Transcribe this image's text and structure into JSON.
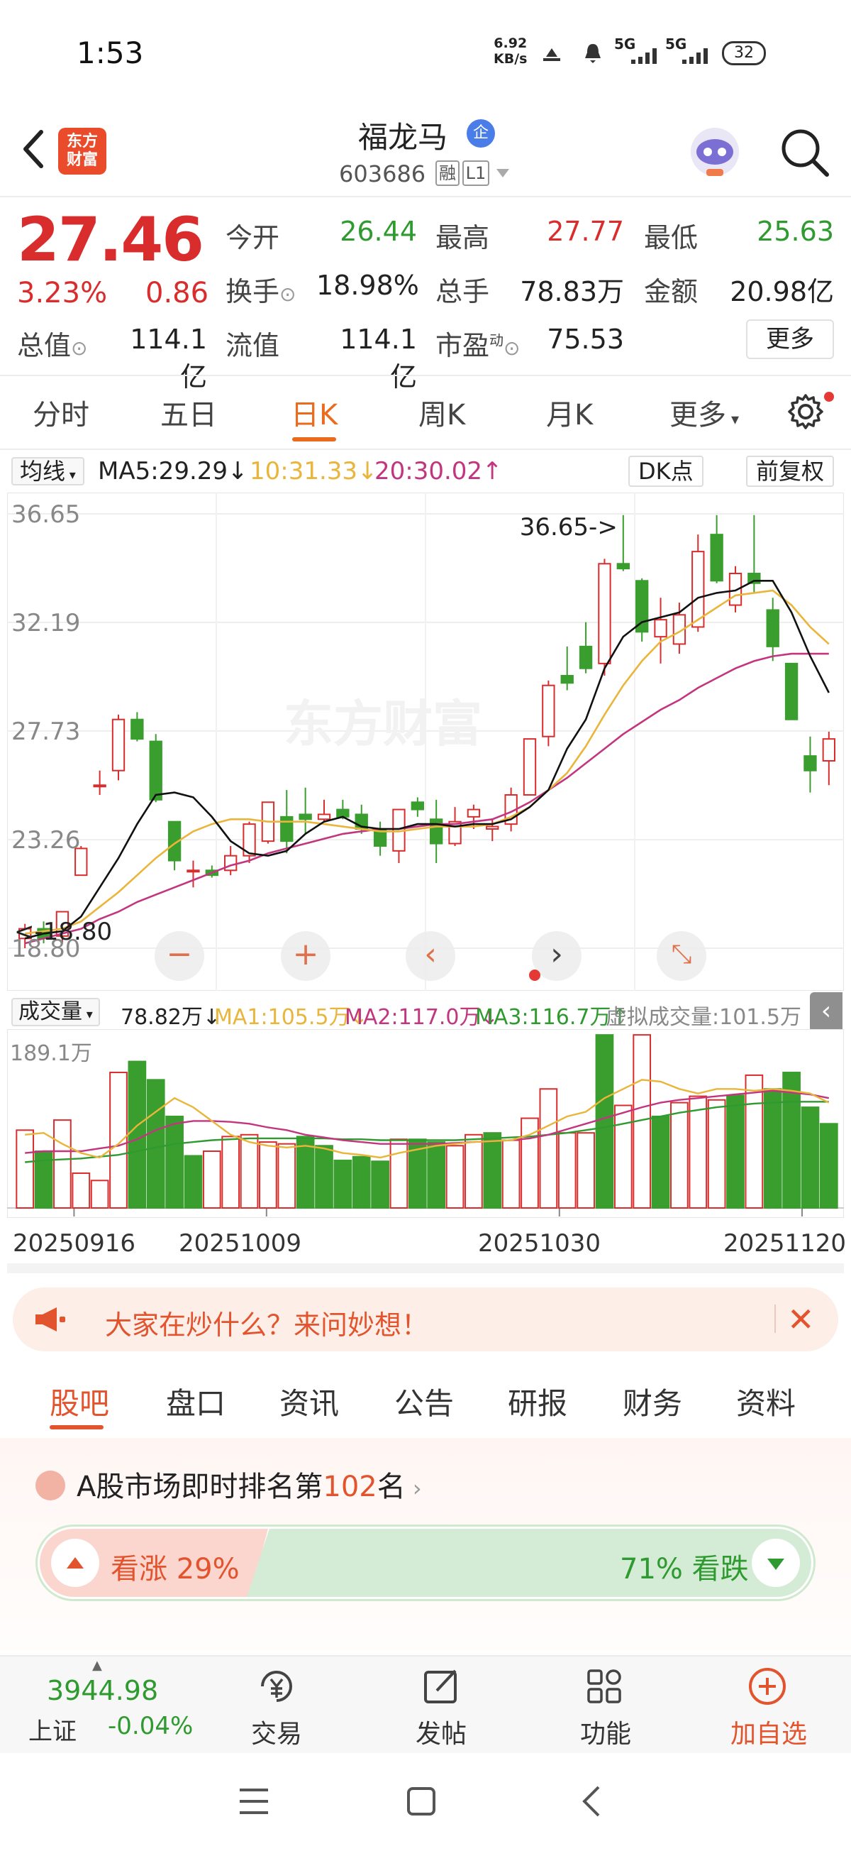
{
  "status_bar": {
    "time": "1:53",
    "net_speed_value": "6.92",
    "net_speed_unit": "KB/s",
    "signal_1": "5G",
    "signal_2": "5G",
    "battery": "32"
  },
  "header": {
    "brand_logo_line1": "东方",
    "brand_logo_line2": "财富",
    "stock_name": "福龙马",
    "qi_badge": "企",
    "stock_code": "603686",
    "tag_rong": "融",
    "tag_level": "L1"
  },
  "quote": {
    "last_price": "27.46",
    "change_pct": "3.23%",
    "change_abs": "0.86",
    "open_label": "今开",
    "open_value": "26.44",
    "high_label": "最高",
    "high_value": "27.77",
    "low_label": "最低",
    "low_value": "25.63",
    "turnover_label": "换手",
    "turnover_value": "18.98%",
    "volume_label": "总手",
    "volume_value": "78.83万",
    "amount_label": "金额",
    "amount_value": "20.98亿",
    "total_mv_label": "总值",
    "total_mv_value": "114.1亿",
    "float_mv_label": "流值",
    "float_mv_value": "114.1亿",
    "pe_label": "市盈",
    "pe_sup": "动",
    "pe_value": "75.53",
    "more_label": "更多"
  },
  "chart_tabs": [
    "分时",
    "五日",
    "日K",
    "周K",
    "月K",
    "更多"
  ],
  "chart_tabs_active": 2,
  "ma_bar": {
    "select_label": "均线",
    "ma5": "MA5:29.29↓",
    "ma10": "10:31.33↓",
    "ma20": "20:30.02↑",
    "dk_label": "DK点",
    "fq_label": "前复权"
  },
  "volume_bar": {
    "select_label": "成交量",
    "vol": "78.82万↓",
    "ma1": "MA1:105.5万↓",
    "ma2": "MA2:117.0万↓",
    "ma3": "MA3:116.7万↑",
    "virtual": "虚拟成交量:101.5万",
    "ymax_label": "189.1万"
  },
  "dates": [
    "20250916",
    "20251009",
    "20251030",
    "20251120"
  ],
  "colors": {
    "up": "#d92d2d",
    "down": "#3a9e2e",
    "ma5": "#111111",
    "ma10": "#e9b53a",
    "ma20": "#c2357f",
    "accent": "#ea6b1e"
  },
  "chart_data": {
    "type": "candlestick",
    "y_ticks": [
      "36.65",
      "32.19",
      "27.73",
      "23.26",
      "18.80"
    ],
    "ylim": [
      18.8,
      36.65
    ],
    "annotation_high": "36.65->",
    "annotation_low": "<-18.80",
    "candles": [
      [
        19.2,
        19.8,
        18.8,
        19.6
      ],
      [
        19.6,
        19.9,
        19.0,
        19.2
      ],
      [
        19.3,
        20.3,
        19.0,
        20.3
      ],
      [
        21.8,
        23.0,
        21.8,
        22.9
      ],
      [
        25.5,
        26.1,
        25.1,
        25.5
      ],
      [
        26.1,
        28.4,
        25.7,
        28.2
      ],
      [
        28.2,
        28.5,
        27.3,
        27.4
      ],
      [
        27.3,
        27.6,
        24.8,
        24.9
      ],
      [
        24.0,
        24.0,
        22.0,
        22.4
      ],
      [
        22.0,
        22.4,
        21.3,
        22.0
      ],
      [
        22.0,
        22.2,
        21.7,
        21.8
      ],
      [
        22.0,
        23.0,
        21.8,
        22.6
      ],
      [
        22.6,
        24.0,
        22.3,
        23.9
      ],
      [
        23.2,
        24.8,
        23.1,
        24.8
      ],
      [
        24.2,
        25.3,
        22.7,
        23.2
      ],
      [
        24.3,
        25.4,
        23.5,
        24.1
      ],
      [
        24.1,
        24.9,
        24.0,
        24.3
      ],
      [
        24.5,
        24.9,
        24.1,
        24.2
      ],
      [
        24.3,
        24.7,
        23.5,
        23.7
      ],
      [
        23.7,
        24.0,
        22.6,
        23.0
      ],
      [
        22.8,
        24.5,
        22.3,
        24.5
      ],
      [
        24.8,
        25.0,
        24.2,
        24.5
      ],
      [
        24.1,
        24.9,
        22.3,
        23.1
      ],
      [
        23.1,
        24.6,
        23.0,
        24.0
      ],
      [
        24.2,
        24.7,
        23.7,
        24.5
      ],
      [
        23.7,
        24.1,
        23.2,
        23.8
      ],
      [
        23.9,
        25.4,
        23.6,
        25.1
      ],
      [
        25.1,
        27.4,
        25.1,
        27.4
      ],
      [
        27.5,
        29.8,
        27.1,
        29.6
      ],
      [
        30.0,
        31.2,
        29.4,
        29.7
      ],
      [
        31.2,
        32.2,
        30.1,
        30.3
      ],
      [
        30.5,
        34.8,
        30.0,
        34.6
      ],
      [
        34.6,
        36.6,
        34.3,
        34.4
      ],
      [
        33.9,
        34.0,
        31.4,
        31.8
      ],
      [
        31.6,
        33.2,
        30.5,
        32.3
      ],
      [
        31.3,
        33.0,
        30.9,
        32.5
      ],
      [
        32.0,
        35.8,
        31.8,
        35.1
      ],
      [
        35.8,
        36.6,
        33.8,
        33.9
      ],
      [
        32.9,
        34.5,
        32.6,
        34.2
      ],
      [
        34.2,
        36.6,
        33.4,
        33.8
      ],
      [
        32.7,
        33.2,
        30.6,
        31.2
      ],
      [
        30.5,
        30.5,
        28.4,
        28.2
      ],
      [
        26.7,
        27.5,
        25.2,
        26.1
      ],
      [
        26.5,
        27.7,
        25.5,
        27.4
      ]
    ],
    "ma5": [
      19.2,
      19.4,
      19.5,
      20.1,
      21.3,
      22.5,
      23.9,
      25.1,
      25.2,
      25.0,
      24.2,
      23.2,
      22.7,
      22.6,
      22.8,
      23.5,
      24.0,
      24.2,
      23.8,
      23.7,
      23.7,
      23.9,
      23.9,
      23.8,
      23.9,
      23.9,
      24.1,
      24.6,
      25.3,
      27.0,
      28.2,
      30.3,
      31.6,
      32.2,
      32.4,
      32.6,
      33.2,
      33.4,
      33.5,
      33.9,
      33.9,
      32.6,
      30.8,
      29.3
    ],
    "ma10": [
      19.4,
      19.5,
      19.6,
      19.9,
      20.5,
      21.1,
      21.8,
      22.5,
      23.1,
      23.6,
      23.9,
      24.1,
      24.1,
      24.0,
      24.0,
      24.0,
      23.9,
      23.8,
      23.7,
      23.6,
      23.6,
      23.7,
      23.8,
      23.8,
      23.8,
      23.9,
      24.2,
      24.6,
      25.3,
      26.0,
      27.1,
      28.4,
      29.6,
      30.6,
      31.4,
      31.8,
      32.3,
      32.8,
      33.3,
      33.4,
      33.5,
      32.9,
      32.0,
      31.3
    ],
    "ma20": [
      19.0,
      19.2,
      19.4,
      19.6,
      20.0,
      20.3,
      20.7,
      21.0,
      21.3,
      21.6,
      21.9,
      22.2,
      22.4,
      22.7,
      22.9,
      23.1,
      23.3,
      23.5,
      23.6,
      23.7,
      23.7,
      23.8,
      23.9,
      23.9,
      24.0,
      24.1,
      24.4,
      24.8,
      25.3,
      25.8,
      26.4,
      27.0,
      27.6,
      28.1,
      28.6,
      29.0,
      29.5,
      29.9,
      30.3,
      30.6,
      30.8,
      30.9,
      30.9,
      30.9
    ],
    "volume": {
      "ylim": [
        0,
        189.1
      ],
      "values": [
        85,
        62,
        96,
        38,
        30,
        148,
        160,
        140,
        100,
        57,
        62,
        78,
        80,
        72,
        70,
        78,
        68,
        52,
        56,
        51,
        75,
        75,
        72,
        68,
        80,
        82,
        74,
        98,
        130,
        82,
        82,
        189,
        112,
        189,
        100,
        115,
        122,
        118,
        123,
        145,
        130,
        148,
        110,
        92,
        79
      ],
      "up": [
        true,
        false,
        true,
        true,
        true,
        true,
        false,
        false,
        false,
        false,
        true,
        true,
        true,
        true,
        true,
        false,
        false,
        false,
        false,
        false,
        true,
        false,
        false,
        true,
        true,
        false,
        true,
        true,
        true,
        true,
        true,
        false,
        true,
        true,
        false,
        true,
        true,
        true,
        false,
        true,
        false,
        false,
        false,
        false,
        true
      ],
      "ma1": [
        80,
        82,
        70,
        60,
        55,
        70,
        90,
        105,
        120,
        110,
        95,
        80,
        72,
        68,
        66,
        68,
        65,
        60,
        58,
        55,
        60,
        64,
        68,
        70,
        72,
        73,
        74,
        80,
        90,
        100,
        105,
        120,
        130,
        140,
        138,
        130,
        125,
        130,
        130,
        128,
        130,
        128,
        125,
        115,
        105
      ],
      "ma2": [
        60,
        62,
        62,
        62,
        65,
        68,
        75,
        85,
        92,
        95,
        95,
        94,
        92,
        88,
        85,
        80,
        77,
        74,
        72,
        70,
        70,
        70,
        70,
        71,
        72,
        73,
        74,
        76,
        80,
        86,
        92,
        98,
        104,
        110,
        115,
        118,
        120,
        122,
        124,
        126,
        128,
        126,
        124,
        120,
        117
      ],
      "ma3": [
        50,
        52,
        53,
        54,
        56,
        58,
        62,
        66,
        70,
        72,
        74,
        75,
        76,
        76,
        76,
        76,
        76,
        75,
        75,
        74,
        74,
        74,
        74,
        74,
        75,
        76,
        77,
        78,
        80,
        82,
        85,
        88,
        92,
        96,
        100,
        104,
        107,
        110,
        112,
        114,
        115,
        116,
        116,
        116,
        116
      ]
    }
  },
  "banner": {
    "text": "大家在炒什么？来问妙想！"
  },
  "bottom_tabs": [
    "股吧",
    "盘口",
    "资讯",
    "公告",
    "研报",
    "财务",
    "资料"
  ],
  "bottom_tabs_active": 0,
  "sentiment": {
    "rank_prefix": "A股市场即时排名第",
    "rank_num": "102",
    "rank_suffix": "名",
    "up_text": "看涨 29%",
    "down_text": "71% 看跌",
    "up_pct": 0.29
  },
  "toolbar": {
    "index_value": "3944.98",
    "index_name": "上证",
    "index_change": "-0.04%",
    "trade_label": "交易",
    "post_label": "发帖",
    "func_label": "功能",
    "add_label": "加自选"
  }
}
